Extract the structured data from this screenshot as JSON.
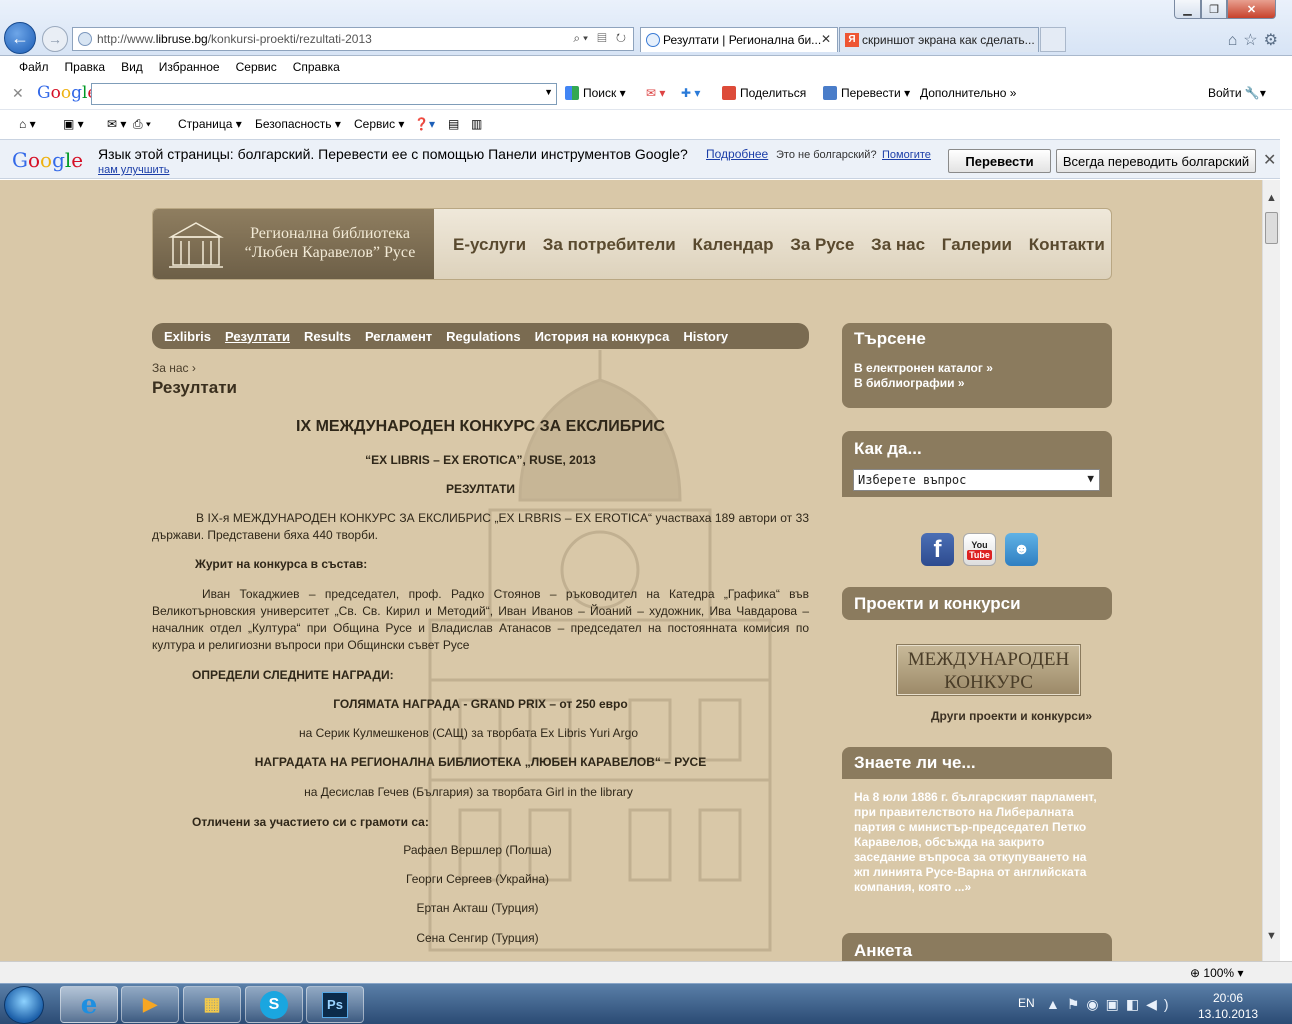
{
  "browser": {
    "url_prefix": "http://www.",
    "url_host": "libruse.bg",
    "url_path": "/konkursi-proekti/rezultati-2013",
    "tab_active": "Резултати | Регионална би...",
    "tab_other": "скриншот экрана как сделать...",
    "menu": [
      "Файл",
      "Правка",
      "Вид",
      "Избранное",
      "Сервис",
      "Справка"
    ]
  },
  "google_toolbar": {
    "logo": "Google",
    "search_value": "",
    "search_btn": "Поиск",
    "share": "Поделиться",
    "translate": "Перевести",
    "more": "Дополнительно",
    "signin": "Войти"
  },
  "command_bar": {
    "page": "Страница",
    "security": "Безопасность",
    "service": "Сервис"
  },
  "translate_bar": {
    "logo": "Google",
    "message": "Язык этой страницы: болгарский. Перевести ее с помощью Панели инструментов Google?",
    "more_link": "Подробнее",
    "not_bulgarian": "Это не болгарский?",
    "help_link_1": "Помогите",
    "help_link_2": "нам улучшить",
    "translate_btn": "Перевести",
    "always_btn": "Всегда переводить болгарский"
  },
  "site": {
    "logo_line1": "Регионална библиотека",
    "logo_line2": "“Любен Каравелов” Русе",
    "nav": [
      "Е-услуги",
      "За потребители",
      "Календар",
      "За Русе",
      "За нас",
      "Галерии",
      "Контакти"
    ],
    "subnav": [
      "Exlibris",
      "Резултати",
      "Results",
      "Регламент",
      "Regulations",
      "История на конкурса",
      "History"
    ],
    "breadcrumb": "За нас ›",
    "page_title": "Резултати"
  },
  "article": {
    "heading": "IX МЕЖДУНАРОДЕН КОНКУРС ЗА ЕКСЛИБРИС",
    "subheading": "“EX LIBRIS – EX EROTICA”, RUSE, 2013",
    "results": "РЕЗУЛТАТИ",
    "intro": "В IX-я МЕЖДУНАРОДЕН КОНКУРС ЗА ЕКСЛИБРИС „EX LRBRIS – EX EROTICA“ участваха 189 автори от 33 държави. Представени бяха 440 творби.",
    "jury_title": "Журит на конкурса в състав:",
    "jury_text": "Иван Токаджиев – председател, проф. Радко Стоянов – ръководител на Катедра „Графика“ във Великотърновския университет „Св. Св. Кирил и Методий“, Иван Иванов – Йоаний – художник, Ива Чавдарова – началник отдел „Култура“ при Община Русе и Владислав Атанасов – председател на постоянната комисия по култура и религиозни въпроси при Общински съвет Русе",
    "awards_title": "ОПРЕДЕЛИ СЛЕДНИТЕ НАГРАДИ:",
    "grand_prix": "ГОЛЯМАТА НАГРАДА - GRAND PRIX – от 250 евро",
    "grand_prix_winner": "на Серик Кулмешкенов (САЩ) за творбата Ex Libris Yuri Argo",
    "library_award": "НАГРАДАТА НА РЕГИОНАЛНА БИБЛИОТЕКА „ЛЮБЕН КАРАВЕЛОВ“ – РУСЕ",
    "library_award_winner": "на Десислав Гечев (България) за творбата Girl in the library",
    "diplomas_title": "Отличени за участието си с грамоти са:",
    "diplomas": [
      "Рафаел Вершлер (Полша)",
      "Георги Сергеев (Украйна)",
      "Ертан Акташ (Турция)",
      "Сена Сенгир (Турция)"
    ]
  },
  "sidebar": {
    "search_title": "Търсене",
    "search_link1": "В електронен каталог »",
    "search_link2": "В библиографии »",
    "how_title": "Как да...",
    "how_select": "Изберете въпрос",
    "projects_title": "Проекти и конкурси",
    "projects_btn_line1": "МЕЖДУНАРОДЕН",
    "projects_btn_line2": "КОНКУРС",
    "projects_more": "Други проекти и конкурси»",
    "know_title": "Знаете ли че...",
    "know_text": "На 8 юли 1886 г. българският парламент, при правителството на Либералната партия с министър-председател Петко Каравелов, обсъжда на закрито заседание въпроса за откупуването на жп линията Русе-Варна от английската компания, която ...»",
    "poll_title": "Анкета"
  },
  "status": {
    "zoom": "100%"
  },
  "taskbar": {
    "lang": "EN",
    "time": "20:06",
    "date": "13.10.2013",
    "ps": "Ps"
  }
}
